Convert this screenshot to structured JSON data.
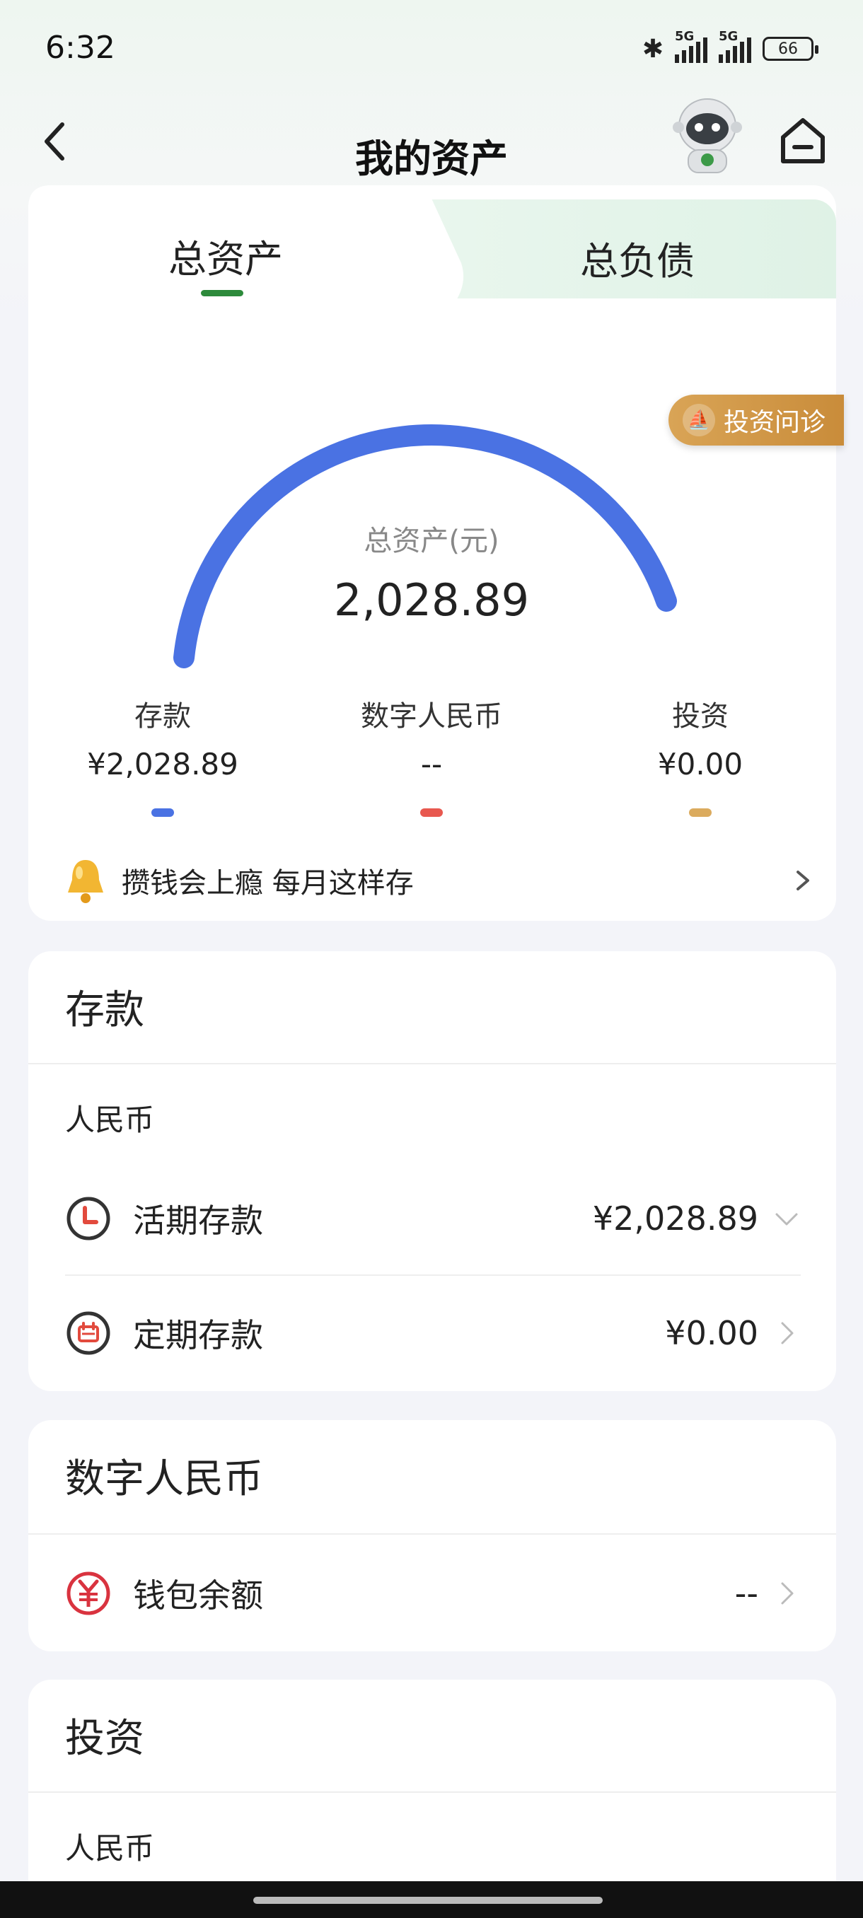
{
  "status_bar": {
    "time": "6:32",
    "network_1": "5G",
    "network_2": "5G",
    "battery": "66"
  },
  "header": {
    "title": "我的资产"
  },
  "tabs": [
    {
      "label": "总资产",
      "active": true
    },
    {
      "label": "总负债",
      "active": false
    }
  ],
  "advice_button": "投资问诊",
  "summary": {
    "label": "总资产(元)",
    "value": "2,028.89",
    "gauge_color": "#4a72e3",
    "categories": [
      {
        "name": "存款",
        "value": "¥2,028.89",
        "color": "#4a72e3"
      },
      {
        "name": "数字人民币",
        "value": "--",
        "color": "#e8584f"
      },
      {
        "name": "投资",
        "value": "¥0.00",
        "color": "#dbab5e"
      }
    ]
  },
  "promo": {
    "text": "攒钱会上瘾 每月这样存"
  },
  "deposit": {
    "title": "存款",
    "currency": "人民币",
    "rows": [
      {
        "label": "活期存款",
        "amount": "¥2,028.89",
        "icon": "clock-icon"
      },
      {
        "label": "定期存款",
        "amount": "¥0.00",
        "icon": "calendar-icon"
      }
    ]
  },
  "digital_rmb": {
    "title": "数字人民币",
    "rows": [
      {
        "label": "钱包余额",
        "amount": "--",
        "icon": "digital-yuan-icon"
      }
    ]
  },
  "investment": {
    "title": "投资",
    "currency": "人民币"
  }
}
